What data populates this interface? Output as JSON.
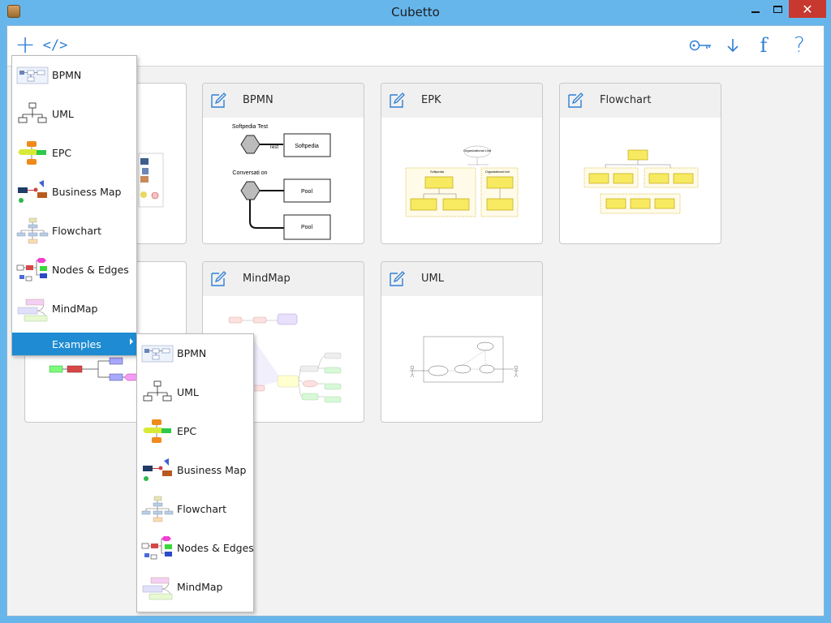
{
  "window": {
    "title": "Cubetto"
  },
  "toolbar": {
    "new_icon": "+",
    "code_icon": "</>",
    "download_icon": "↓",
    "facebook_icon": "f",
    "help_icon": "?"
  },
  "cards": [
    {
      "title": "BPMN"
    },
    {
      "title": "EPK"
    },
    {
      "title": "Flowchart"
    },
    {
      "title": "MindMap"
    },
    {
      "title": "UML"
    }
  ],
  "card_thumbs": {
    "bpmn": {
      "label1": "Softpedia Test",
      "label2": "Test",
      "label3": "Softpedia",
      "label4": "Conversati on",
      "label5": "Pool",
      "label6": "Pool"
    },
    "epk": {
      "label1": "Organizational Unit",
      "label2": "Softpedia",
      "label3": "Organizational Unit"
    }
  },
  "new_menu": {
    "items": [
      {
        "label": "BPMN",
        "icon": "bpmn-icon"
      },
      {
        "label": "UML",
        "icon": "uml-icon"
      },
      {
        "label": "EPC",
        "icon": "epc-icon"
      },
      {
        "label": "Business Map",
        "icon": "business-map-icon"
      },
      {
        "label": "Flowchart",
        "icon": "flowchart-icon"
      },
      {
        "label": "Nodes & Edges",
        "icon": "nodes-edges-icon"
      },
      {
        "label": "MindMap",
        "icon": "mindmap-icon"
      }
    ],
    "examples_label": "Examples"
  },
  "examples_menu": {
    "items": [
      {
        "label": "BPMN",
        "icon": "bpmn-icon"
      },
      {
        "label": "UML",
        "icon": "uml-icon"
      },
      {
        "label": "EPC",
        "icon": "epc-icon"
      },
      {
        "label": "Business Map",
        "icon": "business-map-icon"
      },
      {
        "label": "Flowchart",
        "icon": "flowchart-icon"
      },
      {
        "label": "Nodes & Edges",
        "icon": "nodes-edges-icon"
      },
      {
        "label": "MindMap",
        "icon": "mindmap-icon"
      }
    ]
  },
  "colors": {
    "accent": "#2f7fd6",
    "title_bar": "#66b6ec",
    "menu_highlight": "#1e8bd2",
    "close_button": "#c7382e"
  }
}
